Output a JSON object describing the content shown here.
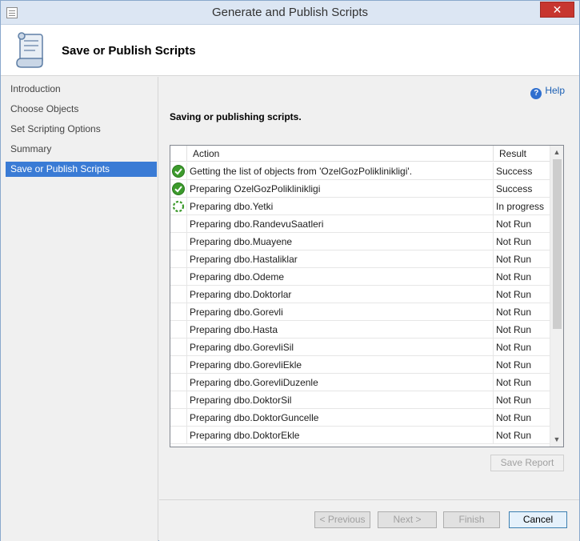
{
  "window": {
    "title": "Generate and Publish Scripts",
    "close_glyph": "✕"
  },
  "header": {
    "title": "Save or Publish Scripts",
    "icon": "script-scroll-icon"
  },
  "sidebar": {
    "items": [
      {
        "label": "Introduction"
      },
      {
        "label": "Choose Objects"
      },
      {
        "label": "Set Scripting Options"
      },
      {
        "label": "Summary"
      },
      {
        "label": "Save or Publish Scripts"
      }
    ],
    "active_index": 4
  },
  "main": {
    "help_label": "Help",
    "heading": "Saving or publishing scripts.",
    "grid": {
      "columns": {
        "action": "Action",
        "result": "Result"
      },
      "rows": [
        {
          "status": "success",
          "action": "Getting the list of objects from 'OzelGozPoliklinikligi'.",
          "result": "Success"
        },
        {
          "status": "success",
          "action": "Preparing OzelGozPoliklinikligi",
          "result": "Success"
        },
        {
          "status": "progress",
          "action": "Preparing dbo.Yetki",
          "result": "In progress"
        },
        {
          "status": "none",
          "action": "Preparing dbo.RandevuSaatleri",
          "result": "Not Run"
        },
        {
          "status": "none",
          "action": "Preparing dbo.Muayene",
          "result": "Not Run"
        },
        {
          "status": "none",
          "action": "Preparing dbo.Hastaliklar",
          "result": "Not Run"
        },
        {
          "status": "none",
          "action": "Preparing dbo.Odeme",
          "result": "Not Run"
        },
        {
          "status": "none",
          "action": "Preparing dbo.Doktorlar",
          "result": "Not Run"
        },
        {
          "status": "none",
          "action": "Preparing dbo.Gorevli",
          "result": "Not Run"
        },
        {
          "status": "none",
          "action": "Preparing dbo.Hasta",
          "result": "Not Run"
        },
        {
          "status": "none",
          "action": "Preparing dbo.GorevliSil",
          "result": "Not Run"
        },
        {
          "status": "none",
          "action": "Preparing dbo.GorevliEkle",
          "result": "Not Run"
        },
        {
          "status": "none",
          "action": "Preparing dbo.GorevliDuzenle",
          "result": "Not Run"
        },
        {
          "status": "none",
          "action": "Preparing dbo.DoktorSil",
          "result": "Not Run"
        },
        {
          "status": "none",
          "action": "Preparing dbo.DoktorGuncelle",
          "result": "Not Run"
        },
        {
          "status": "none",
          "action": "Preparing dbo.DoktorEkle",
          "result": "Not Run"
        }
      ]
    },
    "save_report_label": "Save Report"
  },
  "footer": {
    "previous_label": "< Previous",
    "next_label": "Next >",
    "finish_label": "Finish",
    "cancel_label": "Cancel"
  },
  "colors": {
    "accent": "#3a7bd5",
    "success": "#3c9a2c",
    "close": "#c7362f"
  }
}
